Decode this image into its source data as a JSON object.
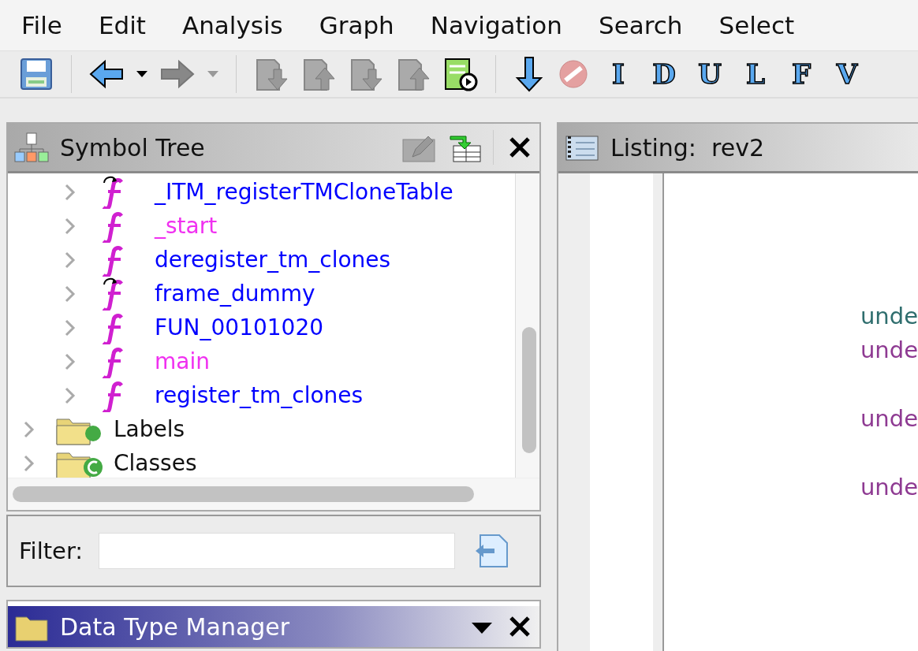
{
  "menu": [
    "File",
    "Edit",
    "Analysis",
    "Graph",
    "Navigation",
    "Search",
    "Select"
  ],
  "toolbar": {
    "letter_buttons": [
      {
        "label": "I"
      },
      {
        "label": "D"
      },
      {
        "label": "U"
      },
      {
        "label": "L"
      },
      {
        "label": "F"
      },
      {
        "label": "V"
      }
    ]
  },
  "symbol_tree": {
    "title": "Symbol Tree",
    "items": [
      {
        "children": [
          {
            "label": "_ITM_registerTMCloneTable",
            "color": "#0000ff",
            "thunk": true,
            "expanded": false
          },
          {
            "label": "_start",
            "color": "#f030f0",
            "thunk": false,
            "expanded": false
          },
          {
            "label": "deregister_tm_clones",
            "color": "#0000ff",
            "thunk": false,
            "expanded": false
          },
          {
            "label": "frame_dummy",
            "color": "#0000ff",
            "thunk": true,
            "expanded": false
          },
          {
            "label": "FUN_00101020",
            "color": "#0000ff",
            "thunk": false,
            "expanded": false
          },
          {
            "label": "main",
            "color": "#f030f0",
            "thunk": false,
            "expanded": false
          },
          {
            "label": "register_tm_clones",
            "color": "#0000ff",
            "thunk": false,
            "expanded": false
          }
        ]
      },
      {
        "label": "Labels",
        "kind": "labels",
        "expanded": false
      },
      {
        "label": "Classes",
        "kind": "classes",
        "expanded": false
      }
    ]
  },
  "filter": {
    "label": "Filter:"
  },
  "data_type_manager": {
    "title": "Data Type Manager"
  },
  "listing": {
    "title": "Listing:  rev2",
    "lines": [
      {
        "text": "unde",
        "color": "#2f6e6e"
      },
      {
        "text": "unde",
        "color": "#8e3a92"
      },
      {
        "text": "unde",
        "color": "#8e3a92"
      },
      {
        "text": "unde",
        "color": "#8e3a92"
      }
    ]
  }
}
